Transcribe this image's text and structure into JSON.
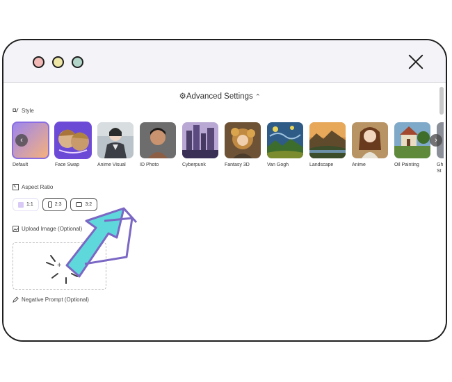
{
  "window": {
    "close_icon": "close-icon",
    "traffic_lights": [
      "#f1b8b6",
      "#eee6a5",
      "#b2d5c9"
    ]
  },
  "advanced": {
    "title": "Advanced Settings",
    "icon": "gear-icon",
    "chevron": "chevron-up-icon"
  },
  "style_section": {
    "label": "Style",
    "items": [
      {
        "label": "Default"
      },
      {
        "label": "Face Swap"
      },
      {
        "label": "Anime Visual"
      },
      {
        "label": "ID Photo"
      },
      {
        "label": "Cyberpunk"
      },
      {
        "label": "Fantasy 3D"
      },
      {
        "label": "Van Gogh"
      },
      {
        "label": "Landscape"
      },
      {
        "label": "Anime"
      },
      {
        "label": "Oil Painting"
      },
      {
        "label": "Gh St"
      }
    ]
  },
  "aspect_section": {
    "label": "Aspect Ratio",
    "options": [
      {
        "label": "1:1",
        "selected": true
      },
      {
        "label": "2:3",
        "selected": false
      },
      {
        "label": "3:2",
        "selected": false
      }
    ]
  },
  "upload_section": {
    "label": "Upload Image (Optional)",
    "plus": "+"
  },
  "negative_section": {
    "label": "Negative Prompt (Optional)"
  },
  "accent_color": "#8a6de0",
  "arrow_color": "#5fd8dc"
}
